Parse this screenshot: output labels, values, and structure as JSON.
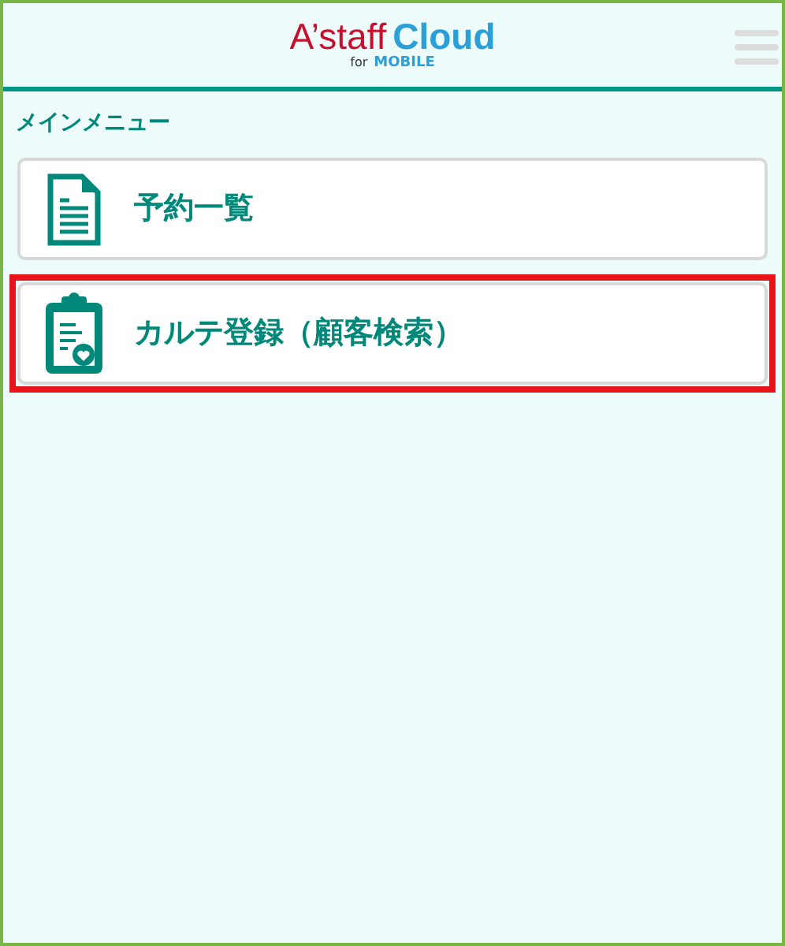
{
  "header": {
    "logo": {
      "brand": "A’staff",
      "product": "Cloud",
      "for": "for",
      "platform": "MOBILE"
    }
  },
  "menu": {
    "title": "メインメニュー",
    "items": [
      {
        "label": "予約一覧",
        "kind": "document",
        "highlighted": false
      },
      {
        "label": "カルテ登録（顧客検索）",
        "kind": "clipboard",
        "highlighted": true
      }
    ]
  }
}
